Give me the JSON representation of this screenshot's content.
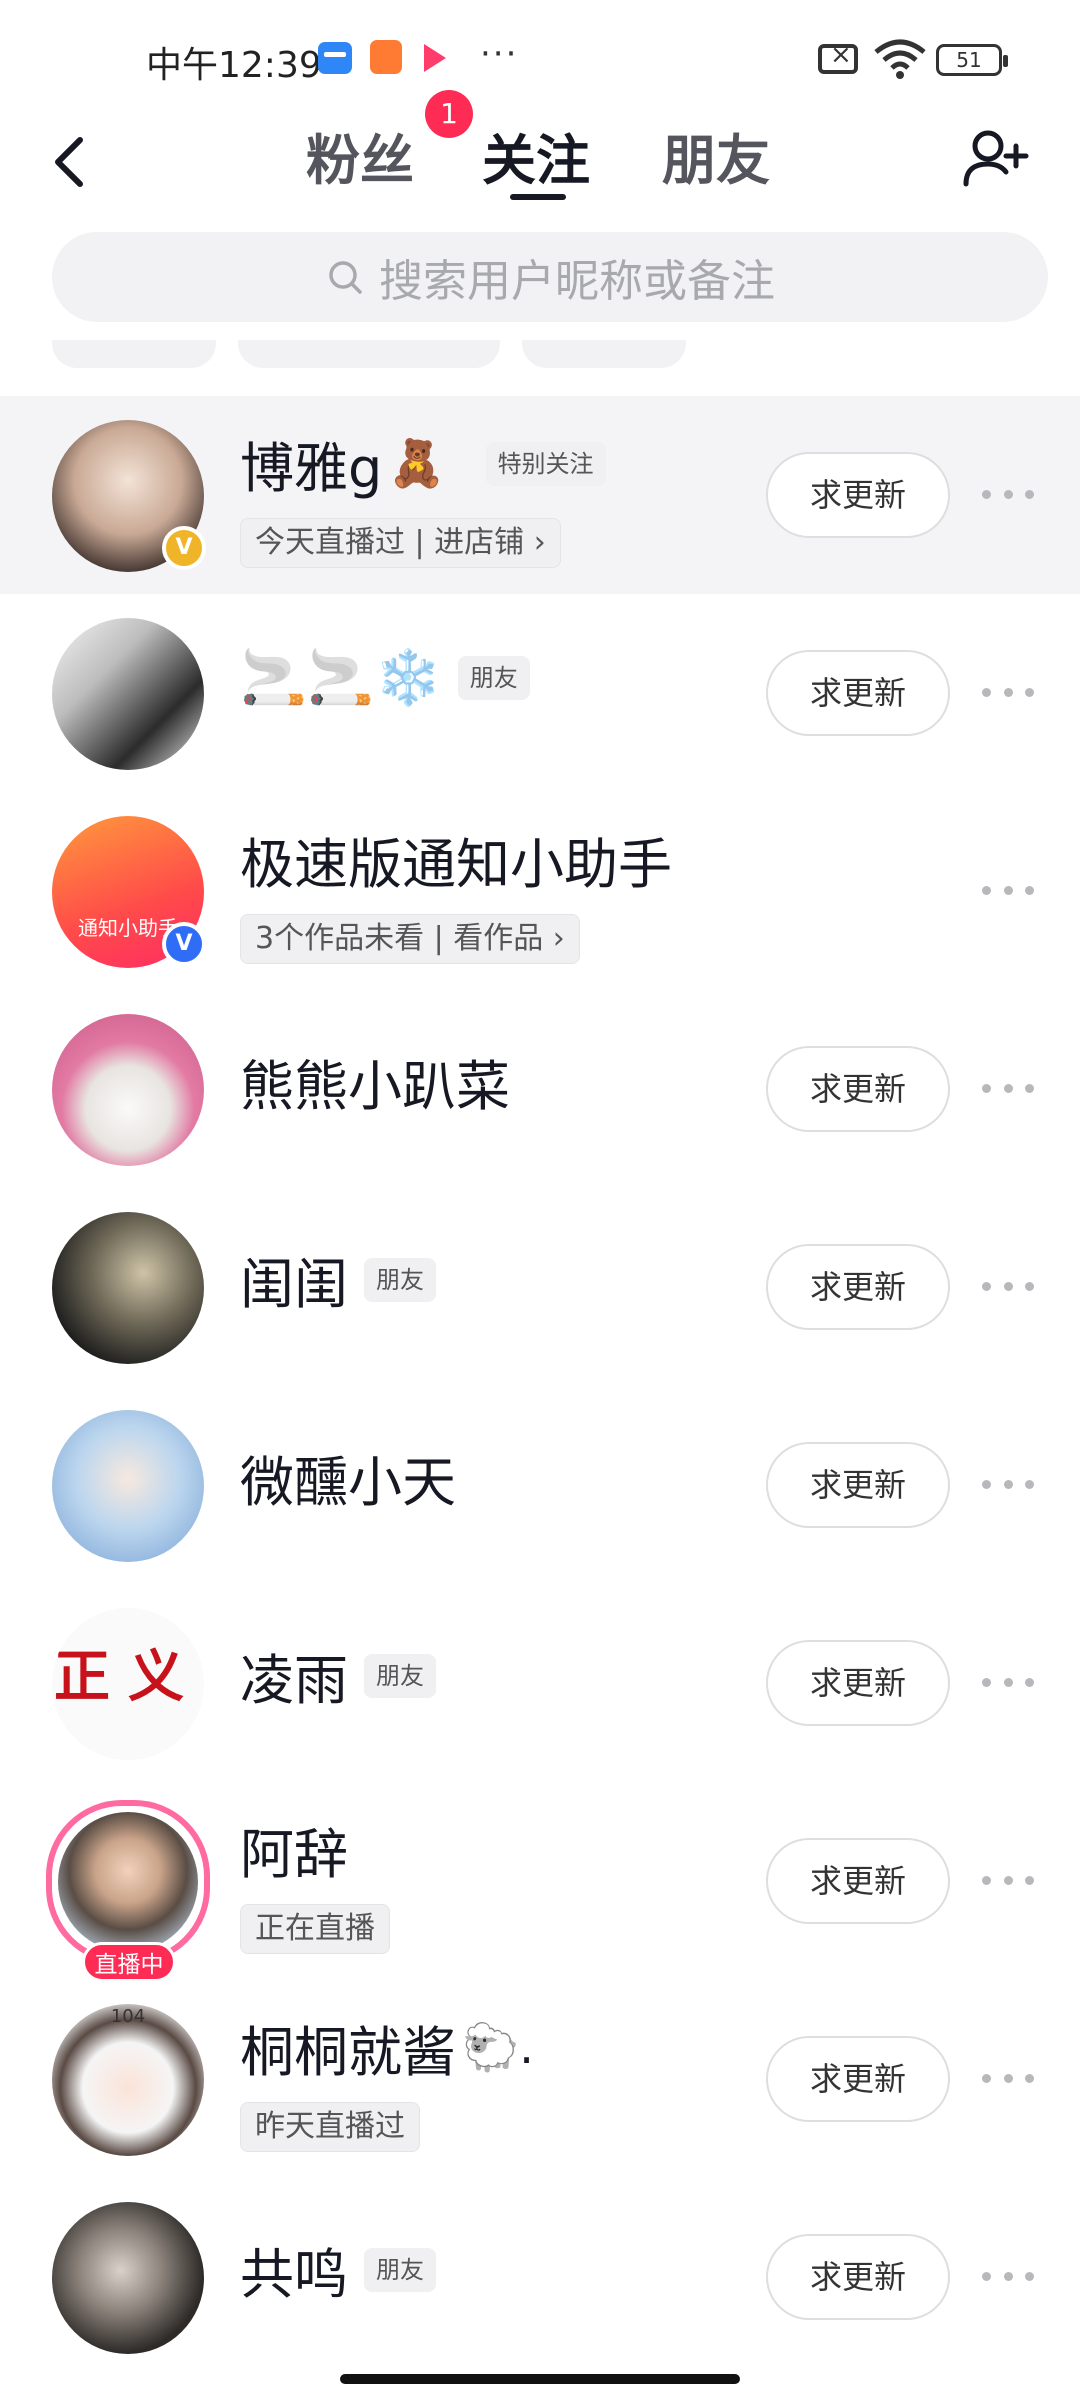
{
  "status_bar": {
    "time": "中午12:39",
    "battery": "51"
  },
  "nav": {
    "tabs": [
      {
        "label": "粉丝"
      },
      {
        "label": "关注"
      },
      {
        "label": "朋友"
      }
    ],
    "fans_badge": "1",
    "active_tab": "关注"
  },
  "search": {
    "placeholder": "搜索用户昵称或备注"
  },
  "users": [
    {
      "name": "博雅g",
      "emoji": "🧸",
      "tag": "特别关注",
      "sub": "今天直播过 | 进店铺 ›",
      "button": "求更新",
      "badge": "V"
    },
    {
      "name": "🚬🚬❄️",
      "tag": "朋友",
      "button": "求更新"
    },
    {
      "name": "极速版通知小助手",
      "sub": "3个作品未看 | 看作品 ›",
      "badge": "V",
      "avatar_text": "通知小助手"
    },
    {
      "name": "熊熊小趴菜",
      "button": "求更新"
    },
    {
      "name": "闺闺",
      "tag": "朋友",
      "button": "求更新"
    },
    {
      "name": "微醺小天",
      "button": "求更新"
    },
    {
      "name": "凌雨",
      "tag": "朋友",
      "button": "求更新",
      "avatar_text": "正义"
    },
    {
      "name": "阿辞",
      "sub": "正在直播",
      "button": "求更新",
      "live": "直播中"
    },
    {
      "name": "桐桐就酱",
      "emoji": "🐑.",
      "sub": "昨天直播过",
      "button": "求更新",
      "avatar_text": "104"
    },
    {
      "name": "共鸣",
      "tag": "朋友",
      "button": "求更新"
    }
  ]
}
